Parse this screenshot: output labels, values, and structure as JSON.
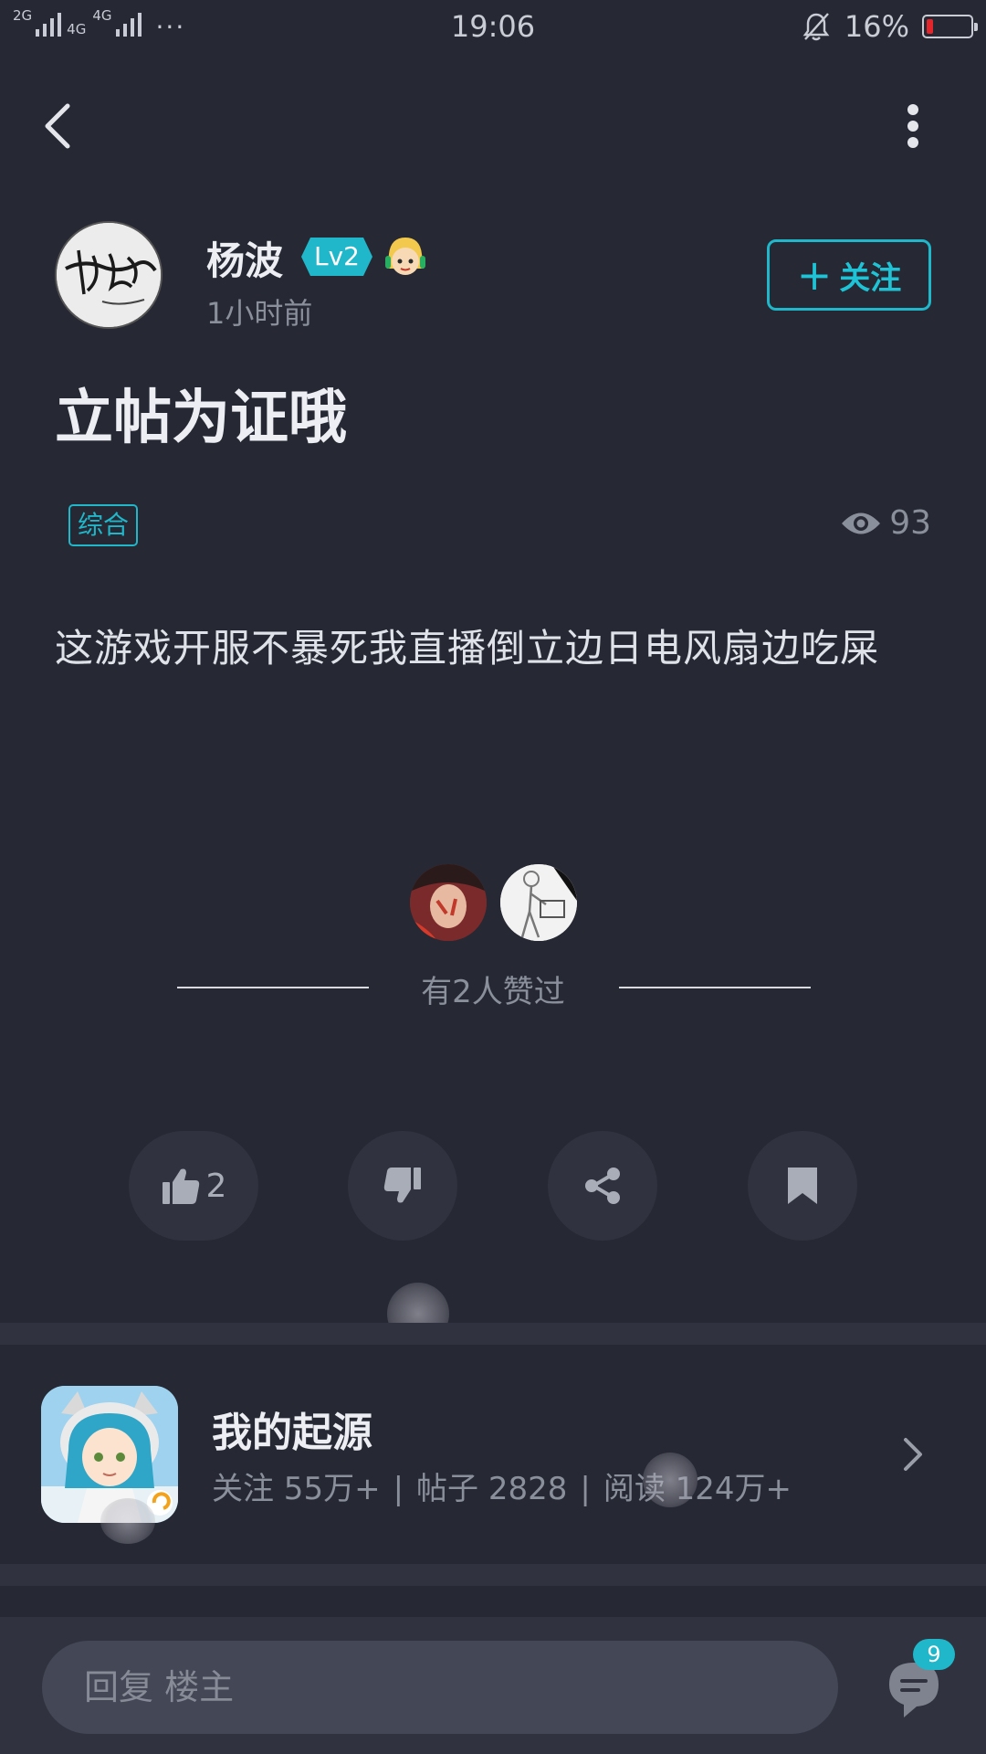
{
  "status_bar": {
    "network_1": "2G",
    "network_2": "4G",
    "network_3": "4G",
    "overflow": "···",
    "time": "19:06",
    "battery_percent": "16%",
    "battery_level": 0.16,
    "battery_color": "#e2262c"
  },
  "post": {
    "author_name": "杨波",
    "level": "Lv2",
    "time_ago": "1小时前",
    "follow_label": "关注",
    "title": "立帖为证哦",
    "tag": "综合",
    "view_count": "93",
    "body": "这游戏开服不暴死我直播倒立边日电风扇边吃屎"
  },
  "likes": {
    "summary": "有2人赞过"
  },
  "actions": {
    "like_count": "2",
    "icons": [
      "thumbs-up-icon",
      "thumbs-down-icon",
      "share-icon",
      "bookmark-icon"
    ]
  },
  "game": {
    "name": "我的起源",
    "follow_stat": "关注 55万+",
    "post_stat": "帖子 2828",
    "read_stat": "阅读 124万+",
    "separator": "|"
  },
  "bottom": {
    "reply_placeholder": "回复  楼主",
    "comment_count": "9"
  },
  "colors": {
    "background": "#262833",
    "accent": "#1fb7c9",
    "button_bg": "#30333f"
  }
}
